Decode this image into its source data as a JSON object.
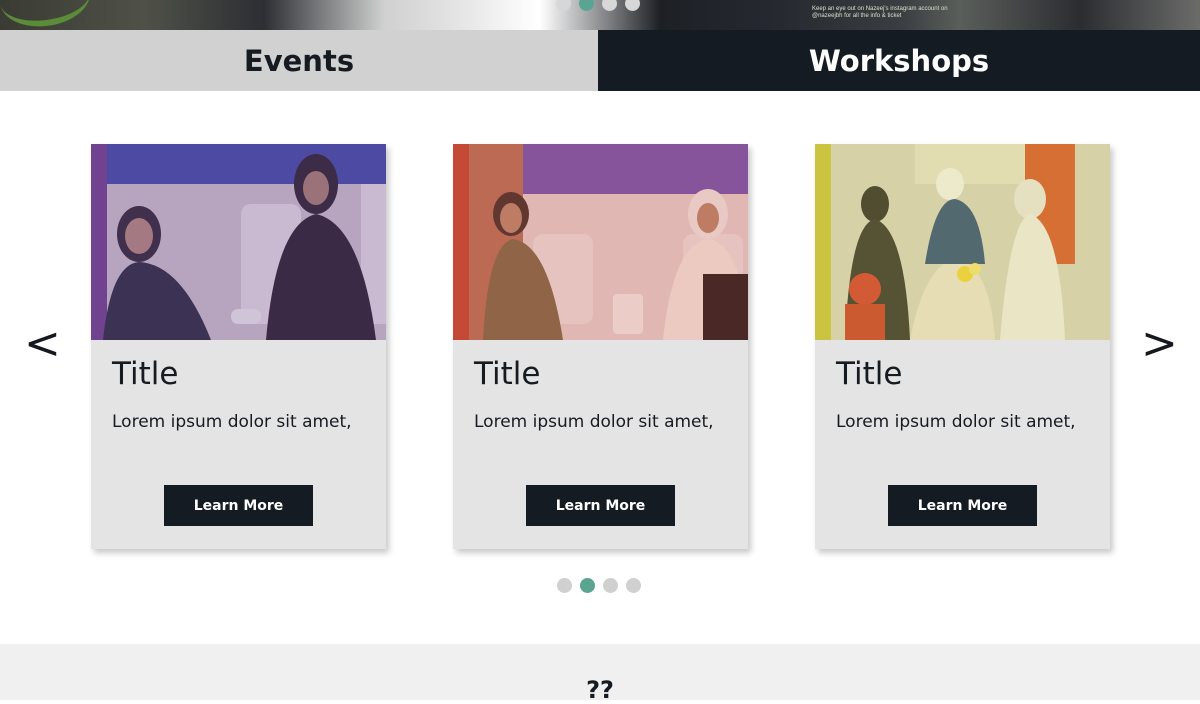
{
  "hero": {
    "instagram_note": "Keep an eye out on Nazeej's instagram account on @nazeejbh for all the info & ticket",
    "slides": 4,
    "active_slide": 2
  },
  "tabs": [
    {
      "label": "Events",
      "active": true
    },
    {
      "label": "Workshops",
      "active": false
    }
  ],
  "nav": {
    "prev": "<",
    "next": ">"
  },
  "cards": [
    {
      "title": "Title",
      "description": "Lorem ipsum dolor sit amet,",
      "button": "Learn More",
      "overlay": "#7a4e9b",
      "photo": "two-women-seated-panel"
    },
    {
      "title": "Title",
      "description": "Lorem ipsum dolor sit amet,",
      "button": "Learn More",
      "overlay": "#d0553f",
      "photo": "two-women-conversation"
    },
    {
      "title": "Title",
      "description": "Lorem ipsum dolor sit amet,",
      "button": "Learn More",
      "overlay": "#d2cf4a",
      "photo": "crowded-event-hall"
    }
  ],
  "carousel": {
    "dot_count": 4,
    "active_index": 1
  },
  "bottom": {
    "heading": "??"
  },
  "colors": {
    "dark": "#151b22",
    "tab_inactive": "#d1d1d1",
    "card_bg": "#e4e4e4",
    "accent": "#5aa592",
    "dot": "#d0d0d0"
  }
}
